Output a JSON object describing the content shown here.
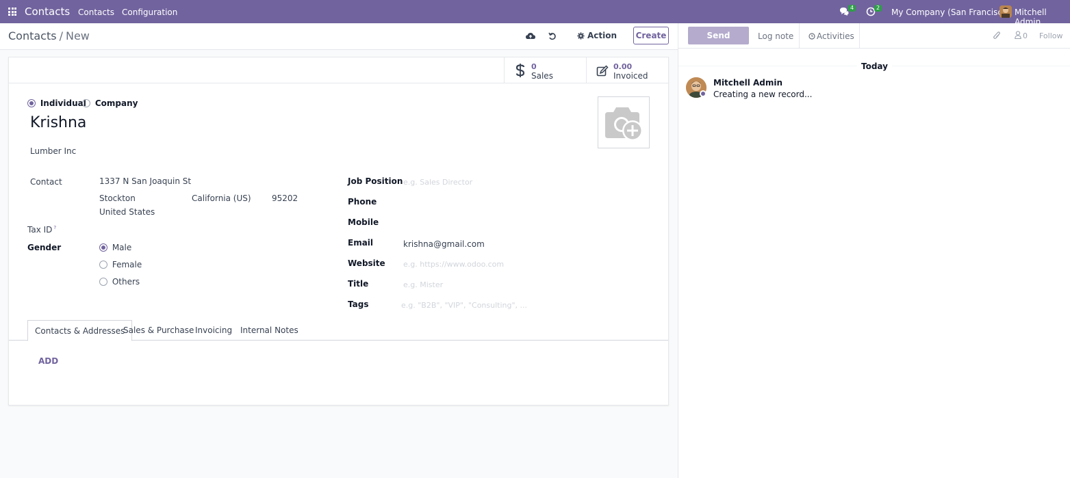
{
  "navbar": {
    "brand": "Contacts",
    "menu": [
      "Contacts",
      "Configuration"
    ],
    "messages_count": "4",
    "activities_count": "2",
    "company": "My Company (San Francisco)",
    "user": "Mitchell Admin"
  },
  "control_panel": {
    "breadcrumb_parent": "Contacts",
    "breadcrumb_separator": "/",
    "breadcrumb_current": "New",
    "action_label": "Action",
    "create_label": "Create"
  },
  "stat_buttons": [
    {
      "value": "0",
      "label": "Sales",
      "icon": "dollar-icon"
    },
    {
      "value": "0.00",
      "label": "Invoiced",
      "icon": "edit-icon"
    }
  ],
  "form": {
    "type_options": [
      {
        "label": "Individual",
        "checked": true
      },
      {
        "label": "Company",
        "checked": false
      }
    ],
    "name": "Krishna",
    "company_name": "Lumber Inc",
    "contact_label": "Contact",
    "address": {
      "street": "1337 N San Joaquin St",
      "city": "Stockton",
      "state": "California (US)",
      "zip": "95202",
      "country": "United States"
    },
    "tax_id_label": "Tax ID",
    "tax_id_help": "?",
    "gender_label": "Gender",
    "gender_options": [
      {
        "label": "Male",
        "checked": true
      },
      {
        "label": "Female",
        "checked": false
      },
      {
        "label": "Others",
        "checked": false
      }
    ],
    "job_position_label": "Job Position",
    "job_position_placeholder": "e.g. Sales Director",
    "phone_label": "Phone",
    "mobile_label": "Mobile",
    "email_label": "Email",
    "email_value": "krishna@gmail.com",
    "website_label": "Website",
    "website_placeholder": "e.g. https://www.odoo.com",
    "title_label": "Title",
    "title_placeholder": "e.g. Mister",
    "tags_label": "Tags",
    "tags_placeholder": "e.g. \"B2B\", \"VIP\", \"Consulting\", ..."
  },
  "tabs": [
    "Contacts & Addresses",
    "Sales & Purchase",
    "Invoicing",
    "Internal Notes"
  ],
  "add_label": "ADD",
  "chatter": {
    "send_message": "Send message",
    "log_note": "Log note",
    "activities": "Activities",
    "followers_count": "0",
    "follow": "Follow",
    "date_separator": "Today",
    "message_author": "Mitchell Admin",
    "message_body": "Creating a new record..."
  },
  "colors": {
    "brand": "#71639e",
    "badge": "#2e9e48"
  }
}
